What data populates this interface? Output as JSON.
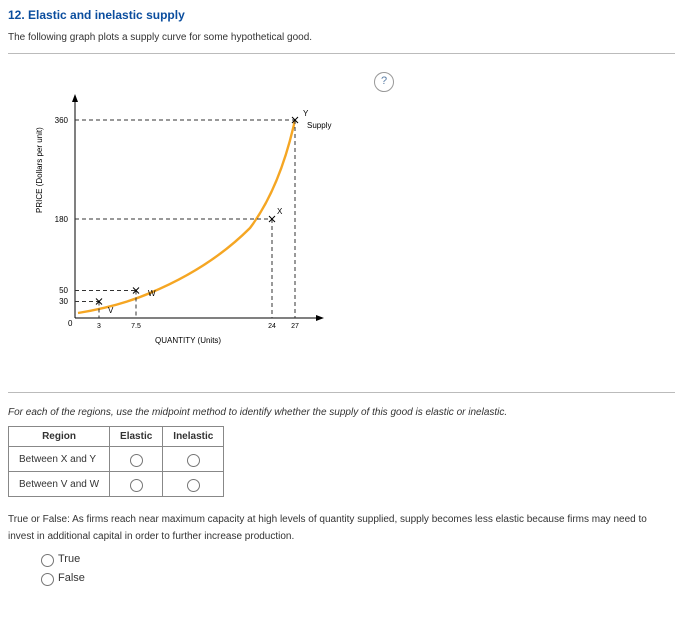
{
  "title": "12. Elastic and inelastic supply",
  "description": "The following graph plots a supply curve for some hypothetical good.",
  "help_label": "?",
  "chart_data": {
    "type": "line",
    "title": "",
    "xlabel": "QUANTITY (Units)",
    "ylabel": "PRICE (Dollars per unit)",
    "xlim": [
      0,
      30
    ],
    "ylim": [
      0,
      400
    ],
    "series_label": "Supply",
    "points": [
      {
        "name": "V",
        "x": 3,
        "y": 30
      },
      {
        "name": "W",
        "x": 7.5,
        "y": 50
      },
      {
        "name": "X",
        "x": 24,
        "y": 180
      },
      {
        "name": "Y",
        "x": 27,
        "y": 360
      }
    ],
    "x_ticks": [
      "3",
      "7.5",
      "24",
      "27"
    ],
    "y_ticks": [
      "30",
      "50",
      "180",
      "360"
    ],
    "origin_label": "0"
  },
  "instr": "For each of the regions, use the midpoint method to identify whether the supply of this good is elastic or inelastic.",
  "table": {
    "headers": [
      "Region",
      "Elastic",
      "Inelastic"
    ],
    "rows": [
      "Between X and Y",
      "Between V and W"
    ]
  },
  "tf_prompt": "True or False: As firms reach near maximum capacity at high levels of quantity supplied, supply becomes less elastic because firms may need to invest in additional capital in order to further increase production.",
  "tf_options": [
    "True",
    "False"
  ]
}
